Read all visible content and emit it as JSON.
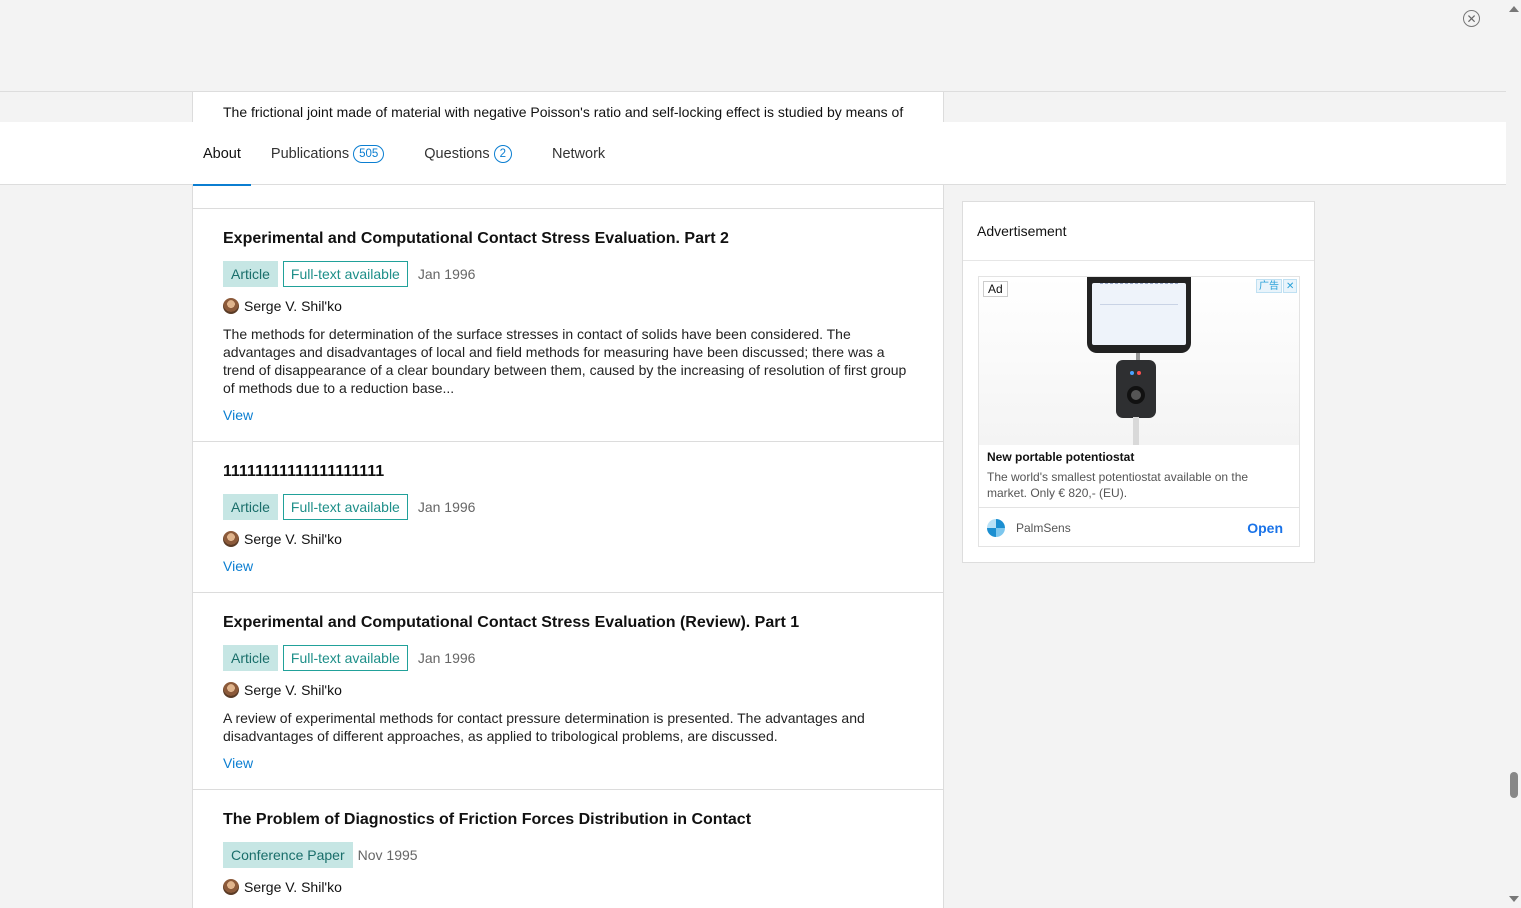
{
  "peek_text": "The frictional joint made of material with negative Poisson's ratio and self-locking effect is studied by means of",
  "tabs": [
    {
      "label": "About"
    },
    {
      "label": "Publications",
      "count": "505"
    },
    {
      "label": "Questions",
      "count": "2"
    },
    {
      "label": "Network"
    }
  ],
  "publications": [
    {
      "title": "Experimental and Computational Contact Stress Evaluation. Part 2",
      "type": "Article",
      "fulltext": "Full-text available",
      "date": "Jan 1996",
      "author": "Serge V. Shil'ko",
      "abstract": "The methods for determination of the surface stresses in contact of solids have been considered. The advantages and disadvantages of local and field methods for measuring have been discussed; there was a trend of disappearance of a clear boundary between them, caused by the increasing of resolution of first group of methods due to a reduction base...",
      "view": "View"
    },
    {
      "title": "11111111111111111111",
      "type": "Article",
      "fulltext": "Full-text available",
      "date": "Jan 1996",
      "author": "Serge V. Shil'ko",
      "abstract": "",
      "view": "View"
    },
    {
      "title": "Experimental and Computational Contact Stress Evaluation (Review). Part 1",
      "type": "Article",
      "fulltext": "Full-text available",
      "date": "Jan 1996",
      "author": "Serge V. Shil'ko",
      "abstract": "A review of experimental methods for contact pressure determination is presented. The advantages and disadvantages of different approaches, as applied to tribological problems, are discussed.",
      "view": "View"
    },
    {
      "title": "The Problem of Diagnostics of Friction Forces Distribution in Contact",
      "type": "Conference Paper",
      "fulltext": "",
      "date": "Nov 1995",
      "author": "Serge V. Shil'ko",
      "abstract": "",
      "view": ""
    }
  ],
  "ad": {
    "card_title": "Advertisement",
    "label": "Ad",
    "adchoice": "广告",
    "headline": "New portable potentiostat",
    "description": "The world's smallest potentiostat available on the market. Only € 820,- (EU).",
    "advertiser": "PalmSens",
    "cta": "Open"
  },
  "colors": {
    "accent": "#0b7ed1",
    "badge_bg": "#c6e6e4",
    "badge_border": "#21a19a"
  },
  "icons": {
    "banner_close": "close-circle-icon",
    "adchoice_close": "close-icon"
  }
}
